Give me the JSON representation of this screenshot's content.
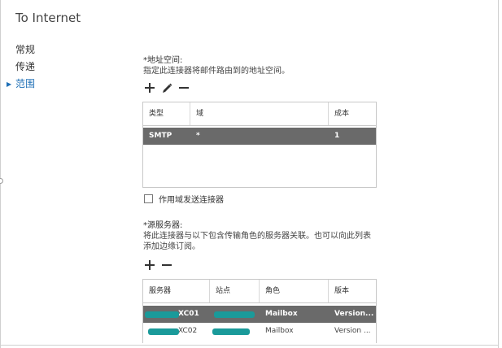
{
  "window": {
    "title": "To Internet"
  },
  "nav": {
    "items": [
      {
        "label": "常规",
        "active": false
      },
      {
        "label": "传递",
        "active": false
      },
      {
        "label": "范围",
        "active": true
      }
    ]
  },
  "address_space": {
    "label": "*地址空间:",
    "description": "指定此连接器将邮件路由到的地址空间。",
    "toolbar": [
      "add-icon",
      "edit-icon",
      "remove-icon"
    ],
    "columns": [
      "类型",
      "域",
      "成本"
    ],
    "rows": [
      {
        "type": "SMTP",
        "domain": "*",
        "cost": "1",
        "selected": true
      }
    ]
  },
  "scoped_send": {
    "label": "作用域发送连接器",
    "checked": false
  },
  "source_servers": {
    "label": "*源服务器:",
    "description_line1": "将此连接器与以下包含传输角色的服务器关联。也可以向此列表",
    "description_line2": "添加边缘订阅。",
    "toolbar": [
      "add-icon",
      "remove-icon"
    ],
    "columns": [
      "服务器",
      "站点",
      "角色",
      "版本"
    ],
    "rows": [
      {
        "server": "XC01",
        "site": "",
        "role": "Mailbox",
        "version": "Version...",
        "selected": true
      },
      {
        "server": "XC02",
        "site": "",
        "role": "Mailbox",
        "version": "Version ...",
        "selected": false
      }
    ]
  },
  "colors": {
    "accent": "#1e6fb6",
    "selected_row": "#6a6a6a",
    "redaction": "#1a9a9a"
  }
}
